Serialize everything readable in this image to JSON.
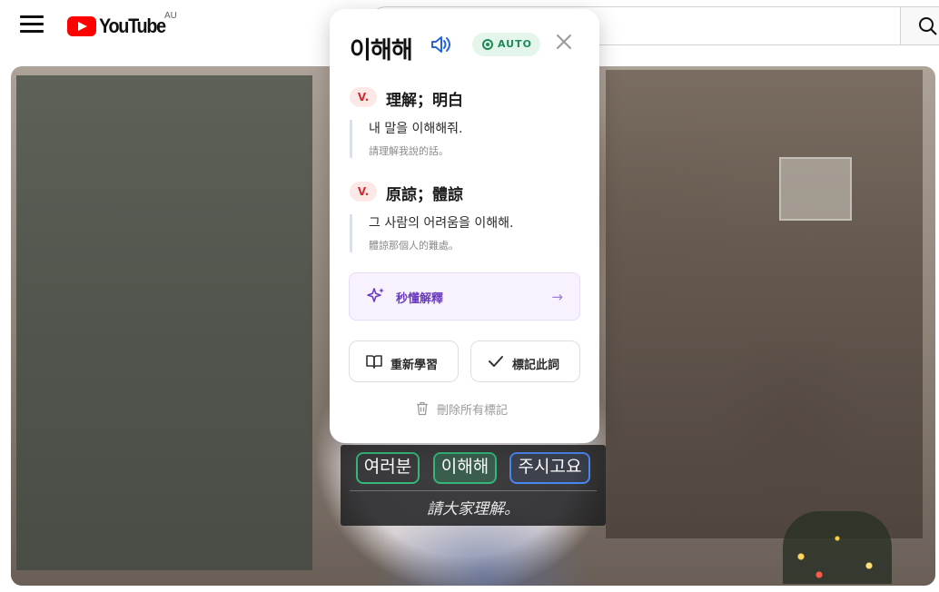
{
  "header": {
    "logo_text": "YouTube",
    "region": "AU",
    "icons": {
      "menu": "hamburger-menu-icon",
      "search": "search-icon"
    }
  },
  "subtitle": {
    "words": [
      "여러분",
      "이해해",
      "주시고요"
    ],
    "translation": "請大家理解。"
  },
  "popup": {
    "word": "이해해",
    "auto_label": "AUTO",
    "senses": [
      {
        "pos": "V.",
        "definition": "理解；明白",
        "example_ko": "내 말을 이해해줘.",
        "example_zh": "請理解我說的話。"
      },
      {
        "pos": "V.",
        "definition": "原諒；體諒",
        "example_ko": "그 사람의 어려움을 이해해.",
        "example_zh": "體諒那個人的難處。"
      }
    ],
    "ai_explain_label": "秒懂解釋",
    "relearn_label": "重新學習",
    "mark_label": "標記此詞",
    "delete_all_label": "刪除所有標記"
  },
  "colors": {
    "youtube_red": "#ff0000",
    "chip_green": "#35b77a",
    "chip_blue": "#4a86f0",
    "auto_badge": "#1f8a57",
    "pos_badge": "#d22d2d",
    "ai_accent": "#6a3cc1"
  }
}
